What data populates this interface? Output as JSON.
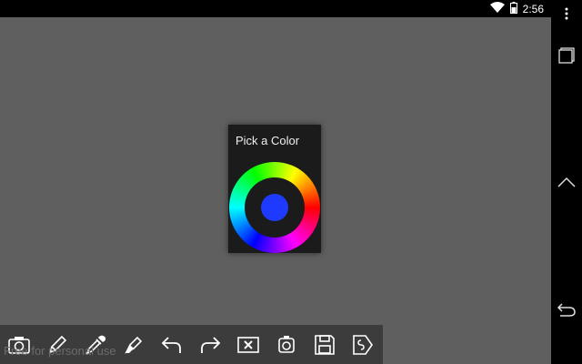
{
  "status_bar": {
    "time": "2:56",
    "wifi_icon": "wifi-icon",
    "battery_icon": "battery-icon"
  },
  "nav_bar": {
    "menu_icon": "overflow-menu-icon",
    "recents_icon": "recent-apps-icon",
    "home_icon": "home-icon",
    "back_icon": "back-icon"
  },
  "color_picker": {
    "title": "Pick a Color",
    "selected_color": "#1f3aff"
  },
  "toolbar": {
    "tools": [
      {
        "name": "camera-icon"
      },
      {
        "name": "pencil-icon"
      },
      {
        "name": "eyedropper-icon"
      },
      {
        "name": "marker-icon"
      },
      {
        "name": "undo-icon"
      },
      {
        "name": "redo-icon"
      },
      {
        "name": "clear-canvas-icon"
      },
      {
        "name": "rotate-camera-icon"
      },
      {
        "name": "save-icon"
      },
      {
        "name": "send-icon"
      }
    ]
  },
  "watermark": "Free for personal use"
}
